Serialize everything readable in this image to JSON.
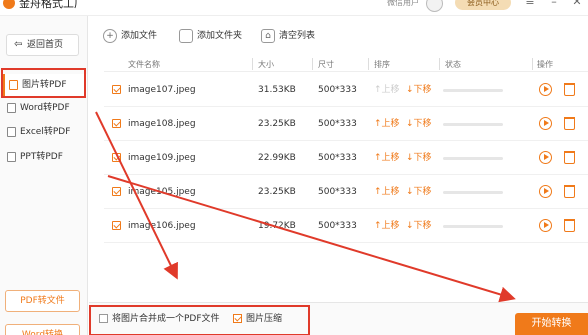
{
  "app": {
    "title": "金舟格式工厂",
    "user_label": "微信用户",
    "vip_label": "会员中心",
    "controls": [
      "menu-icon",
      "minimize-icon",
      "close-icon"
    ]
  },
  "sidebar": {
    "back_label": "返回首页",
    "items": [
      {
        "label": "图片转PDF",
        "active": true
      },
      {
        "label": "Word转PDF",
        "active": false
      },
      {
        "label": "Excel转PDF",
        "active": false
      },
      {
        "label": "PPT转PDF",
        "active": false
      }
    ],
    "bottom_items": [
      {
        "label": "PDF转文件"
      },
      {
        "label": "Word转换"
      }
    ]
  },
  "toolbar": {
    "add_file": "添加文件",
    "add_folder": "添加文件夹",
    "clear_list": "清空列表"
  },
  "table": {
    "headers": {
      "name": "文件名称",
      "size": "大小",
      "dimension": "尺寸",
      "sort": "排序",
      "status": "状态",
      "operation": "操作"
    },
    "sort_up_label": "上移",
    "sort_down_label": "下移",
    "rows": [
      {
        "name": "image107.jpeg",
        "size": "31.53KB",
        "dimension": "500*333",
        "up_enabled": false,
        "progress": 0
      },
      {
        "name": "image108.jpeg",
        "size": "23.25KB",
        "dimension": "500*333",
        "up_enabled": true,
        "progress": 0
      },
      {
        "name": "image109.jpeg",
        "size": "22.99KB",
        "dimension": "500*333",
        "up_enabled": true,
        "progress": 0
      },
      {
        "name": "image105.jpeg",
        "size": "23.25KB",
        "dimension": "500*333",
        "up_enabled": true,
        "progress": 0
      },
      {
        "name": "image106.jpeg",
        "size": "19.72KB",
        "dimension": "500*333",
        "up_enabled": true,
        "progress": 0
      }
    ]
  },
  "bottom": {
    "merge_label": "将图片合并成一个PDF文件",
    "merge_checked": false,
    "compress_label": "图片压缩",
    "compress_checked": true,
    "start_label": "开始转换"
  },
  "colors": {
    "accent": "#f07a1a",
    "annotation": "#e03a2a"
  }
}
